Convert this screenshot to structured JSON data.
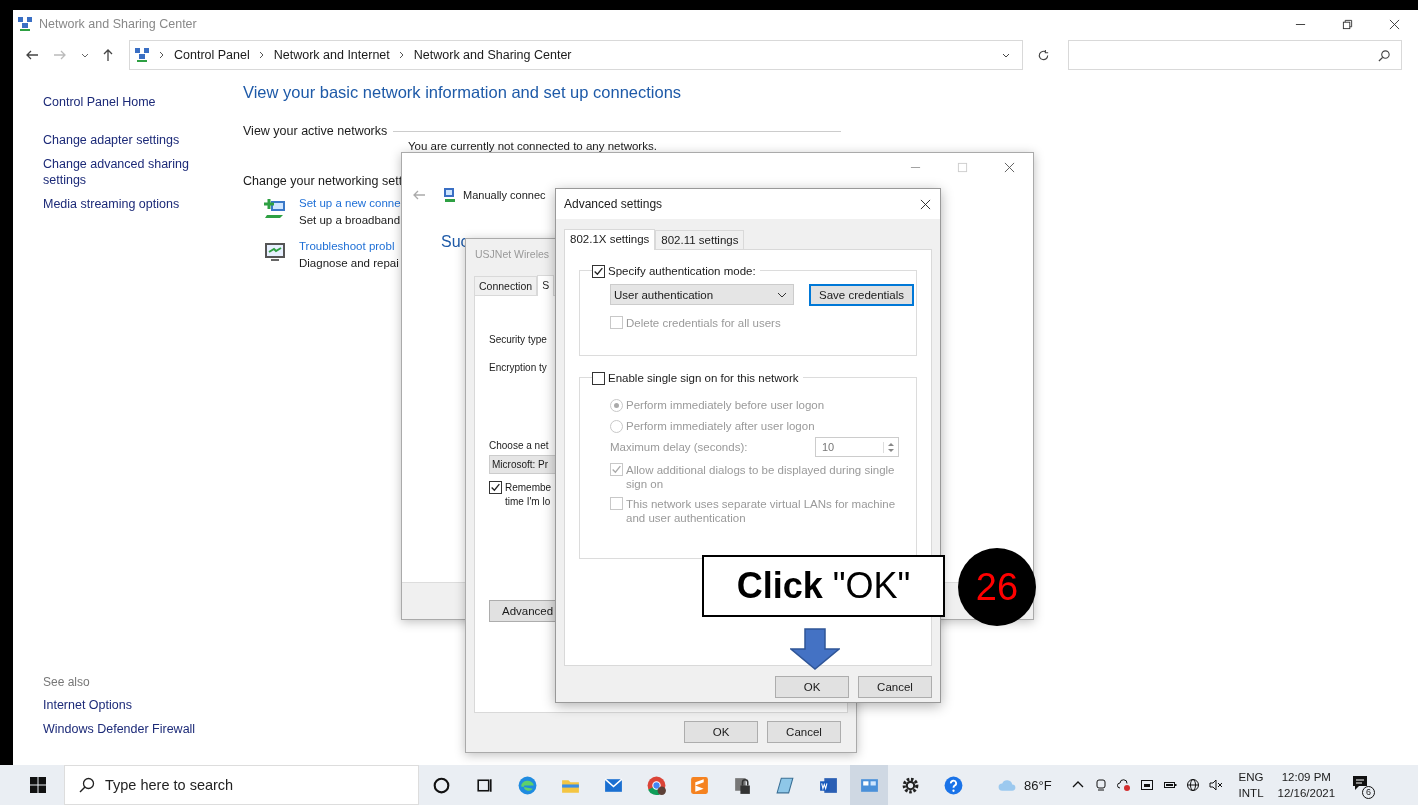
{
  "window": {
    "title": "Network and Sharing Center"
  },
  "breadcrumb": [
    "Control Panel",
    "Network and Internet",
    "Network and Sharing Center"
  ],
  "sidebar": {
    "links": [
      "Control Panel Home",
      "Change adapter settings",
      "Change advanced sharing settings",
      "Media streaming options"
    ],
    "see_also_heading": "See also",
    "see_also": [
      "Internet Options",
      "Windows Defender Firewall"
    ]
  },
  "main": {
    "heading": "View your basic network information and set up connections",
    "active_networks_label": "View your active networks",
    "not_connected": "You are currently not connected to any networks.",
    "change_settings_label": "Change your networking sett",
    "tasks": [
      {
        "link": "Set up a new conne",
        "desc": "Set up a broadband"
      },
      {
        "link": "Troubleshoot probl",
        "desc": "Diagnose and repai"
      }
    ]
  },
  "connect_wizard": {
    "title": "Manually connec",
    "heading": "Suc"
  },
  "wireless_properties": {
    "title": "USJNet Wireles",
    "tabs": [
      {
        "label": "Connection",
        "selected": false
      },
      {
        "label": "S",
        "selected": true
      }
    ],
    "labels": [
      "Security type",
      "Encryption ty"
    ],
    "choose_label": "Choose a net",
    "method": "Microsoft: Pr",
    "remember": {
      "lines": [
        "Remembe",
        "time I'm lo"
      ],
      "checked": true
    },
    "advanced_button": "Advanced",
    "buttons": [
      "OK",
      "Cancel"
    ]
  },
  "advanced_settings": {
    "title": "Advanced settings",
    "tabs": [
      {
        "label": "802.1X settings",
        "selected": true
      },
      {
        "label": "802.11 settings",
        "selected": false
      }
    ],
    "specify_auth": {
      "label": "Specify authentication mode:",
      "checked": true
    },
    "auth_mode": "User authentication",
    "save_button": "Save credentials",
    "delete_credentials": {
      "label": "Delete credentials for all users",
      "checked": false,
      "disabled": true
    },
    "single_sign_on": {
      "label": "Enable single sign on for this network",
      "checked": false
    },
    "radios": [
      {
        "label": "Perform immediately before user logon",
        "selected": true,
        "disabled": true
      },
      {
        "label": "Perform immediately after user logon",
        "selected": false,
        "disabled": true
      }
    ],
    "max_delay": {
      "label": "Maximum delay (seconds):",
      "value": "10",
      "disabled": true
    },
    "options": [
      {
        "label": "Allow additional dialogs to be displayed during single sign on",
        "checked": true,
        "disabled": true
      },
      {
        "label": "This network uses separate virtual LANs for machine and user authentication",
        "checked": false,
        "disabled": true
      }
    ],
    "buttons": [
      "OK",
      "Cancel"
    ]
  },
  "callout": {
    "text": "**Click** \"OK\"",
    "step": "26"
  },
  "taskbar": {
    "search_placeholder": "Type here to search",
    "weather": "86°F",
    "language": [
      "ENG",
      "INTL"
    ],
    "time": "12:09 PM",
    "date": "12/16/2021",
    "notifications": "6"
  }
}
